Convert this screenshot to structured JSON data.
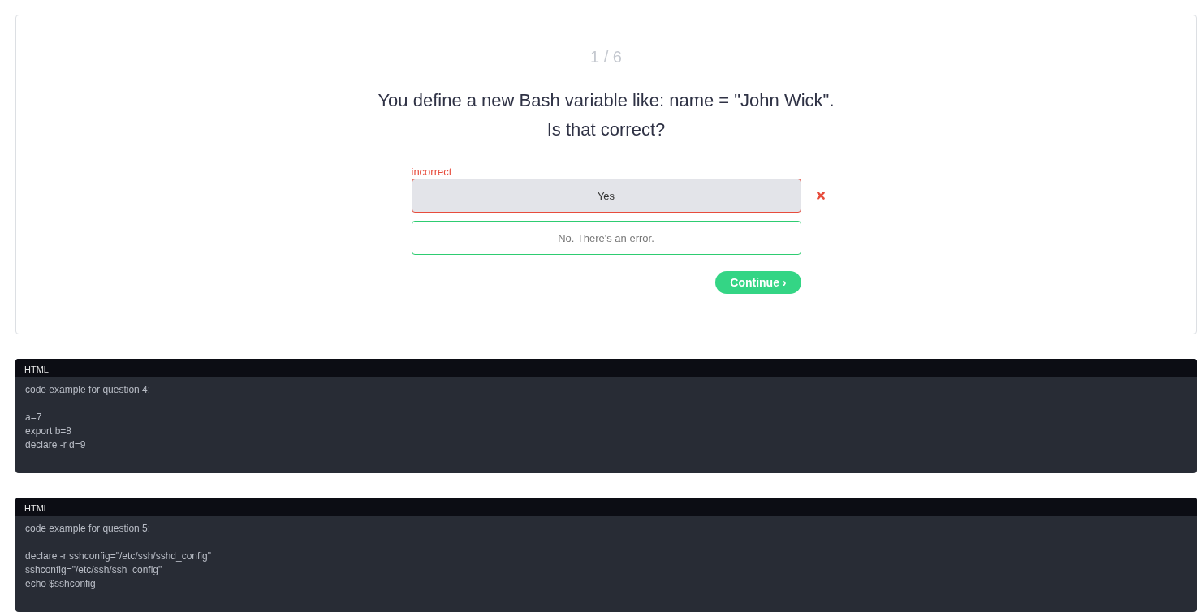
{
  "quiz": {
    "counter": "1 / 6",
    "question": [
      "You define a new Bash variable like: name = \"John Wick\".",
      "Is that correct?"
    ],
    "options": [
      {
        "label": "Yes",
        "selected": true,
        "is_correct": false,
        "feedback": "incorrect"
      },
      {
        "label": "No. There's an error.",
        "selected": false,
        "is_correct": true
      }
    ],
    "continue_button": "Continue ›"
  },
  "code_blocks": [
    {
      "language": "HTML",
      "intro": "code example for question 4:",
      "lines": [
        "a=7",
        "export b=8",
        "declare -r d=9"
      ]
    },
    {
      "language": "HTML",
      "intro": "code example for question 5:",
      "lines": [
        "declare -r sshconfig=\"/etc/ssh/sshd_config\"",
        "sshconfig=\"/etc/ssh/ssh_config\"",
        "echo $sshconfig"
      ]
    }
  ]
}
